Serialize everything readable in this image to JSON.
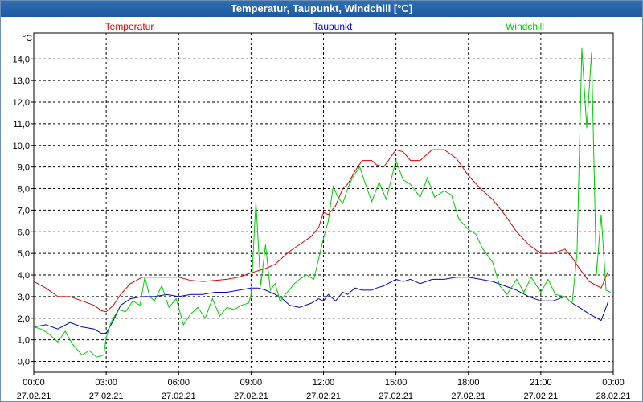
{
  "window_title": "Temperatur, Taupunkt, Windchill [°C]",
  "colors": {
    "temperatur": "#dd0000",
    "taupunkt": "#0000cc",
    "windchill": "#00cc00",
    "grid": "#000000"
  },
  "chart_data": {
    "type": "line",
    "title": "Temperatur, Taupunkt, Windchill [°C]",
    "ylabel": "°C",
    "ylim": [
      -0.5,
      15.2
    ],
    "xlim": [
      0,
      24
    ],
    "grid": true,
    "legend_placement": "top",
    "y_ticks": [
      "0,0",
      "1,0",
      "2,0",
      "3,0",
      "4,0",
      "5,0",
      "6,0",
      "7,0",
      "8,0",
      "9,0",
      "10,0",
      "11,0",
      "12,0",
      "13,0",
      "14,0"
    ],
    "x_ticks": [
      {
        "time": "00:00",
        "date": "27.02.21"
      },
      {
        "time": "03:00",
        "date": "27.02.21"
      },
      {
        "time": "06:00",
        "date": "27.02.21"
      },
      {
        "time": "09:00",
        "date": "27.02.21"
      },
      {
        "time": "12:00",
        "date": "27.02.21"
      },
      {
        "time": "15:00",
        "date": "27.02.21"
      },
      {
        "time": "18:00",
        "date": "27.02.21"
      },
      {
        "time": "21:00",
        "date": "27.02.21"
      },
      {
        "time": "00:00",
        "date": "28.02.21"
      }
    ],
    "series": [
      {
        "name": "Temperatur",
        "x": [
          0,
          0.5,
          1,
          1.5,
          2,
          2.5,
          2.8,
          3.0,
          3.3,
          3.6,
          4.0,
          4.5,
          5,
          5.5,
          6,
          6.5,
          7,
          7.5,
          8,
          8.5,
          9,
          9.3,
          9.6,
          10,
          10.3,
          10.6,
          11,
          11.5,
          11.8,
          12,
          12.2,
          12.5,
          12.8,
          13,
          13.3,
          13.6,
          14,
          14.2,
          14.5,
          15,
          15.3,
          15.6,
          16,
          16.5,
          17,
          17.5,
          18,
          18.5,
          19,
          19.5,
          20,
          20.5,
          21,
          21.5,
          22,
          22.3,
          22.6,
          23,
          23.5,
          23.8
        ],
        "y": [
          3.7,
          3.4,
          3.0,
          3.0,
          2.8,
          2.6,
          2.35,
          2.3,
          2.6,
          3.1,
          3.6,
          3.9,
          3.9,
          3.9,
          3.9,
          3.75,
          3.7,
          3.75,
          3.8,
          3.9,
          4.1,
          4.2,
          4.3,
          4.5,
          4.8,
          5.1,
          5.4,
          5.8,
          6.2,
          6.9,
          6.8,
          7.2,
          8.0,
          8.2,
          8.8,
          9.3,
          9.3,
          9.1,
          9.0,
          9.8,
          9.7,
          9.3,
          9.3,
          9.8,
          9.8,
          9.4,
          8.6,
          8.0,
          7.5,
          6.8,
          6.0,
          5.4,
          5.0,
          5.0,
          5.2,
          4.8,
          4.3,
          3.7,
          3.4,
          4.2
        ]
      },
      {
        "name": "Taupunkt",
        "x": [
          0,
          0.5,
          1,
          1.5,
          2,
          2.5,
          2.8,
          3.0,
          3.3,
          3.6,
          4.0,
          4.5,
          5,
          5.5,
          6,
          6.5,
          7,
          7.5,
          8,
          8.5,
          9,
          9.3,
          9.6,
          10,
          10.3,
          10.6,
          11,
          11.5,
          11.8,
          12,
          12.2,
          12.5,
          12.8,
          13,
          13.3,
          13.6,
          14,
          14.2,
          14.5,
          15,
          15.3,
          15.6,
          16,
          16.5,
          17,
          17.5,
          18,
          18.5,
          19,
          19.5,
          20,
          20.5,
          21,
          21.5,
          22,
          22.3,
          22.6,
          23,
          23.5,
          23.8
        ],
        "y": [
          1.6,
          1.7,
          1.5,
          1.8,
          1.6,
          1.5,
          1.3,
          1.3,
          1.9,
          2.6,
          2.9,
          3.0,
          3.0,
          3.1,
          3.0,
          3.1,
          3.1,
          3.2,
          3.2,
          3.3,
          3.4,
          3.4,
          3.3,
          3.1,
          2.9,
          2.6,
          2.5,
          2.7,
          2.9,
          2.8,
          3.1,
          2.8,
          3.2,
          3.1,
          3.4,
          3.3,
          3.3,
          3.4,
          3.5,
          3.8,
          3.7,
          3.8,
          3.6,
          3.8,
          3.8,
          3.9,
          3.9,
          3.8,
          3.7,
          3.5,
          3.3,
          3.0,
          2.8,
          2.8,
          3.0,
          2.7,
          2.5,
          2.2,
          1.9,
          2.8
        ]
      },
      {
        "name": "Windchill",
        "x": [
          0,
          0.3,
          0.6,
          1,
          1.3,
          1.6,
          2,
          2.3,
          2.6,
          2.9,
          3.0,
          3.2,
          3.5,
          3.8,
          4.1,
          4.4,
          4.6,
          4.8,
          5,
          5.3,
          5.6,
          5.9,
          6.2,
          6.5,
          6.8,
          7.1,
          7.4,
          7.7,
          8,
          8.3,
          8.6,
          8.9,
          9.0,
          9.2,
          9.4,
          9.6,
          9.8,
          10,
          10.2,
          10.5,
          10.8,
          11,
          11.3,
          11.6,
          12,
          12.2,
          12.4,
          12.6,
          12.8,
          13,
          13.2,
          13.5,
          13.8,
          14,
          14.3,
          14.6,
          15,
          15.3,
          15.6,
          16,
          16.3,
          16.6,
          17,
          17.3,
          17.6,
          18,
          18.3,
          18.6,
          19,
          19.3,
          19.6,
          20,
          20.3,
          20.6,
          21,
          21.3,
          21.6,
          22,
          22.3,
          22.5,
          22.7,
          22.9,
          23.1,
          23.3,
          23.5,
          23.7,
          23.9
        ],
        "y": [
          1.6,
          1.5,
          1.3,
          0.9,
          1.4,
          0.8,
          0.3,
          0.5,
          0.2,
          0.3,
          1.1,
          1.8,
          2.4,
          2.3,
          2.8,
          2.6,
          3.9,
          3.0,
          2.8,
          3.5,
          2.5,
          2.9,
          1.7,
          2.2,
          2.5,
          2.0,
          2.9,
          2.1,
          2.5,
          2.4,
          2.6,
          2.7,
          3.1,
          7.4,
          3.5,
          5.4,
          3.3,
          3.6,
          2.8,
          3.2,
          3.6,
          3.8,
          4.0,
          3.8,
          5.7,
          6.5,
          8.1,
          7.6,
          7.3,
          8.0,
          8.5,
          9.0,
          8.0,
          7.4,
          8.3,
          7.5,
          9.3,
          8.4,
          8.2,
          7.6,
          8.5,
          7.6,
          7.9,
          7.7,
          6.6,
          6.1,
          5.9,
          5.2,
          4.6,
          3.5,
          3.1,
          3.8,
          3.2,
          3.9,
          3.2,
          3.8,
          3.1,
          3.0,
          2.7,
          5.0,
          14.5,
          10.8,
          14.3,
          4.0,
          6.8,
          3.3,
          3.2
        ]
      }
    ]
  }
}
